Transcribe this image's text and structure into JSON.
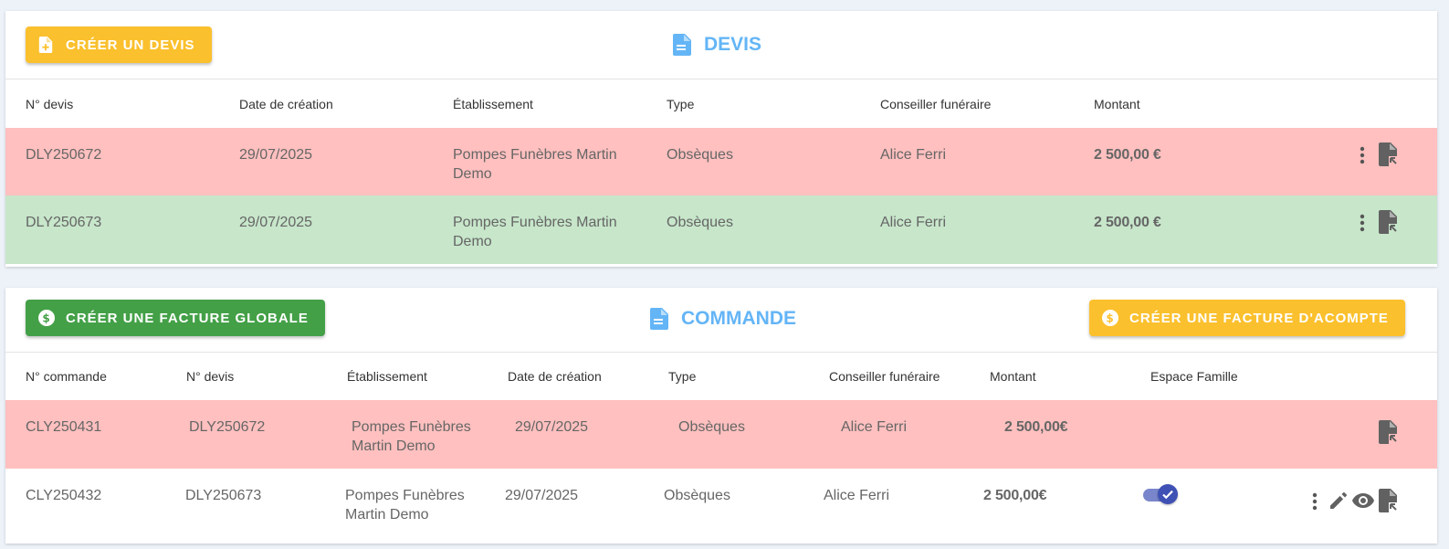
{
  "devis": {
    "create_button": "CRÉER UN DEVIS",
    "title": "DEVIS",
    "columns": [
      "N° devis",
      "Date de création",
      "Établissement",
      "Type",
      "Conseiller funéraire",
      "Montant"
    ],
    "rows": [
      {
        "numero": "DLY250672",
        "date": "29/07/2025",
        "etablissement_l1": "Pompes Funèbres Martin",
        "etablissement_l2": "Demo",
        "type": "Obsèques",
        "conseiller": "Alice Ferri",
        "montant": "2 500,00 €",
        "status_color": "#ffc0bf"
      },
      {
        "numero": "DLY250673",
        "date": "29/07/2025",
        "etablissement_l1": "Pompes Funèbres Martin",
        "etablissement_l2": "Demo",
        "type": "Obsèques",
        "conseiller": "Alice Ferri",
        "montant": "2 500,00 €",
        "status_color": "#c7e6ca"
      }
    ]
  },
  "commande": {
    "create_global_button": "CRÉER UNE FACTURE GLOBALE",
    "title": "COMMANDE",
    "create_acompte_button": "CRÉER UNE FACTURE D'ACOMPTE",
    "columns": [
      "N° commande",
      "N° devis",
      "Établissement",
      "Date de création",
      "Type",
      "Conseiller funéraire",
      "Montant",
      "Espace Famille"
    ],
    "rows": [
      {
        "numero": "CLY250431",
        "devis": "DLY250672",
        "etablissement_l1": "Pompes Funèbres",
        "etablissement_l2": "Martin Demo",
        "date": "29/07/2025",
        "type": "Obsèques",
        "conseiller": "Alice Ferri",
        "montant": "2 500,00€",
        "status_color": "#ffc0bf"
      },
      {
        "numero": "CLY250432",
        "devis": "DLY250673",
        "etablissement_l1": "Pompes Funèbres",
        "etablissement_l2": "Martin Demo",
        "date": "29/07/2025",
        "type": "Obsèques",
        "conseiller": "Alice Ferri",
        "montant": "2 500,00€",
        "espace_famille_enabled": true,
        "status_color": "#ffffff"
      }
    ]
  },
  "colors": {
    "accent_blue": "#64b5f6",
    "yellow": "#fbc02d",
    "green": "#43a047",
    "toggle": "#3f51b5"
  },
  "icons": [
    "file-plus-icon",
    "file-icon",
    "dollar-circle-icon",
    "more-vert-icon",
    "file-export-icon",
    "edit-icon",
    "eye-icon",
    "check-icon"
  ]
}
